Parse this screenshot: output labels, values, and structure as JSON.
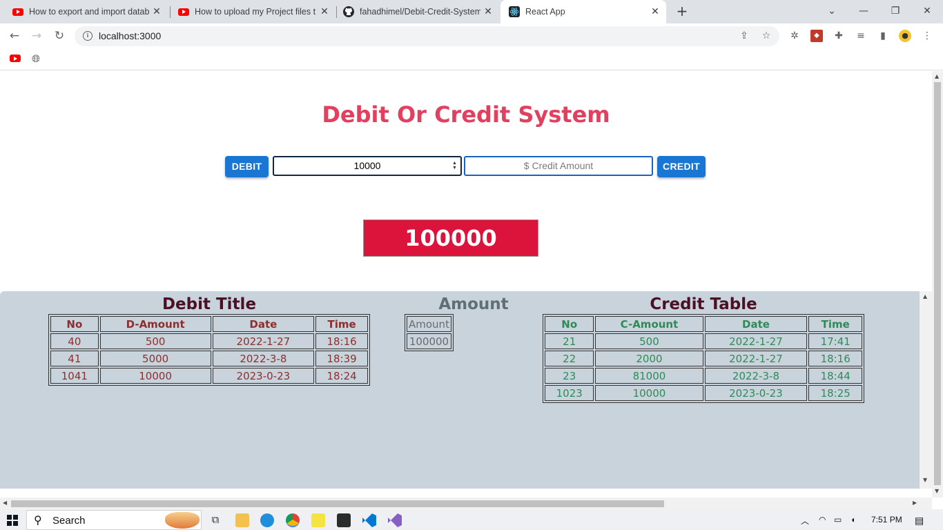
{
  "browser": {
    "tabs": [
      {
        "title": "How to export and import datab",
        "icon": "youtube-icon"
      },
      {
        "title": "How to upload my Project files to",
        "icon": "youtube-icon"
      },
      {
        "title": "fahadhimel/Debit-Credit-System",
        "icon": "github-icon"
      },
      {
        "title": "React App",
        "icon": "react-icon",
        "active": true
      }
    ],
    "url": "localhost:3000"
  },
  "page": {
    "title": "Debit Or Credit System",
    "debit_button": "DEBIT",
    "debit_input_value": "10000",
    "credit_input_placeholder": "$ Credit Amount",
    "credit_button": "CREDIT",
    "balance": "100000"
  },
  "debit": {
    "title": "Debit Title",
    "headers": [
      "No",
      "D-Amount",
      "Date",
      "Time"
    ],
    "rows": [
      [
        "40",
        "500",
        "2022-1-27",
        "18:16"
      ],
      [
        "41",
        "5000",
        "2022-3-8",
        "18:39"
      ],
      [
        "1041",
        "10000",
        "2023-0-23",
        "18:24"
      ]
    ]
  },
  "amount": {
    "title": "Amount",
    "header": "Amount",
    "value": "100000"
  },
  "credit": {
    "title": "Credit Table",
    "headers": [
      "No",
      "C-Amount",
      "Date",
      "Time"
    ],
    "rows": [
      [
        "21",
        "500",
        "2022-1-27",
        "17:41"
      ],
      [
        "22",
        "2000",
        "2022-1-27",
        "18:16"
      ],
      [
        "23",
        "81000",
        "2022-3-8",
        "18:44"
      ],
      [
        "1023",
        "10000",
        "2023-0-23",
        "18:25"
      ]
    ]
  },
  "taskbar": {
    "search_label": "Search",
    "time": "7:51 PM"
  },
  "colors": {
    "title": "#e2405e",
    "button": "#1976d2",
    "balance_bg": "#dc143c",
    "panel_bg": "#c8d3db",
    "debit_text": "#8b2f2f",
    "credit_text": "#2e8b57",
    "amount_title": "#5f6f76"
  }
}
